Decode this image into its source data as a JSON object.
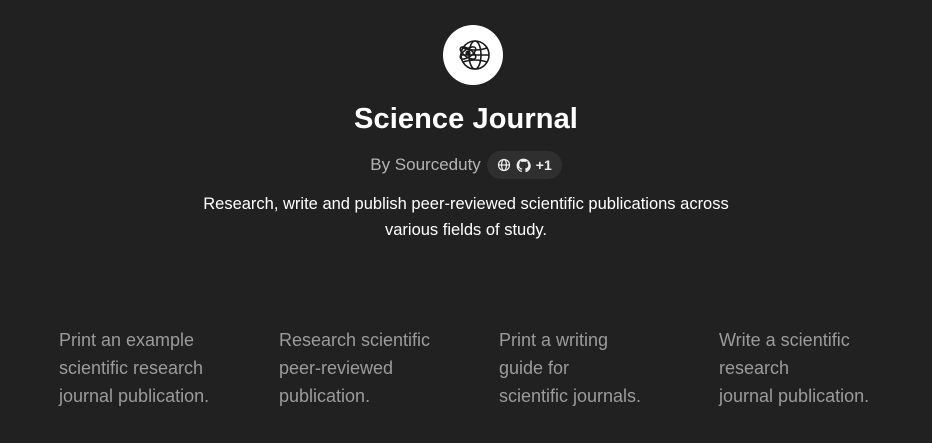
{
  "gpt": {
    "logo_icon": "globe-with-atom-icon",
    "title": "Science Journal",
    "author": "By Sourceduty",
    "links": {
      "website_icon": "globe-icon",
      "github_icon": "github-icon",
      "more_count": "+1"
    },
    "description": "Research, write and publish peer-reviewed scientific publications across various fields of study."
  },
  "conversation_starters": [
    {
      "text": "Print an example\nscientific research\njournal publication."
    },
    {
      "text": "Research scientific\npeer-reviewed\npublication."
    },
    {
      "text": "Print a writing\nguide for\nscientific journals."
    },
    {
      "text": "Write a scientific\nresearch\njournal publication."
    }
  ],
  "colors": {
    "background": "#212121",
    "title": "#ffffff",
    "muted": "#b4b4b4",
    "starter_text": "#9b9b9b",
    "pill_bg": "#2f2f2f"
  }
}
